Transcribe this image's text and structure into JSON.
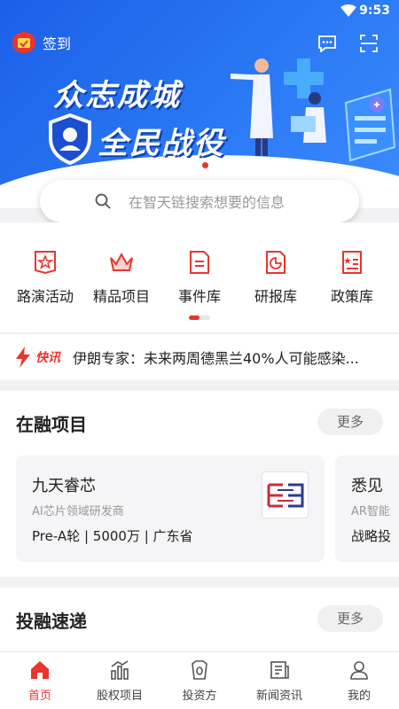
{
  "status": {
    "time": "9:53"
  },
  "header": {
    "signin_label": "签到"
  },
  "banner": {
    "slogan_line1": "众志成城",
    "slogan_line2": "全民战役"
  },
  "search": {
    "placeholder": "在智天链搜索想要的信息"
  },
  "categories": [
    {
      "label": "路演活动",
      "icon": "star-flag-icon"
    },
    {
      "label": "精品项目",
      "icon": "crown-icon"
    },
    {
      "label": "事件库",
      "icon": "document-icon"
    },
    {
      "label": "研报库",
      "icon": "chart-report-icon"
    },
    {
      "label": "政策库",
      "icon": "policy-book-icon"
    }
  ],
  "news": {
    "tag": "快讯",
    "text": "伊朗专家：未来两周德黑兰40%人可能感染..."
  },
  "sections": {
    "projects": {
      "title": "在融项目",
      "more_label": "更多",
      "cards": [
        {
          "name": "九天睿芯",
          "desc": "AI芯片领域研发商",
          "meta": "Pre-A轮 | 5000万 | 广东省"
        },
        {
          "name": "悉见",
          "desc": "AR智能",
          "meta": "战略投"
        }
      ]
    },
    "deals": {
      "title": "投融速递",
      "more_label": "更多"
    }
  },
  "tabbar": [
    {
      "label": "首页",
      "icon": "home-icon",
      "active": true
    },
    {
      "label": "股权项目",
      "icon": "bar-chart-icon",
      "active": false
    },
    {
      "label": "投资方",
      "icon": "investor-icon",
      "active": false
    },
    {
      "label": "新闻资讯",
      "icon": "news-icon",
      "active": false
    },
    {
      "label": "我的",
      "icon": "person-icon",
      "active": false
    }
  ],
  "colors": {
    "accent": "#e9352e",
    "banner_blue": "#2a78f4"
  }
}
